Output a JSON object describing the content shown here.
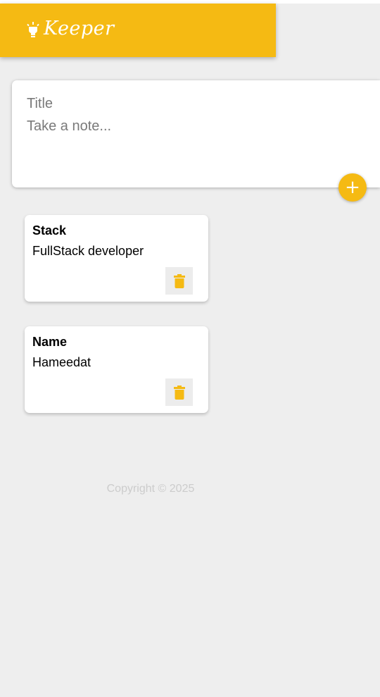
{
  "colors": {
    "accent": "#f5ba13",
    "background": "#eeeeee"
  },
  "header": {
    "icon": "lightbulb-icon",
    "title": "Keeper"
  },
  "create_area": {
    "title_placeholder": "Title",
    "content_placeholder": "Take a note...",
    "add_icon": "plus-icon",
    "add_symbol": "+"
  },
  "notes": [
    {
      "title": "Stack",
      "content": "FullStack developer",
      "delete_icon": "trash-icon"
    },
    {
      "title": "Name",
      "content": "Hameedat",
      "delete_icon": "trash-icon"
    }
  ],
  "footer": {
    "text": "Copyright © 2025"
  }
}
